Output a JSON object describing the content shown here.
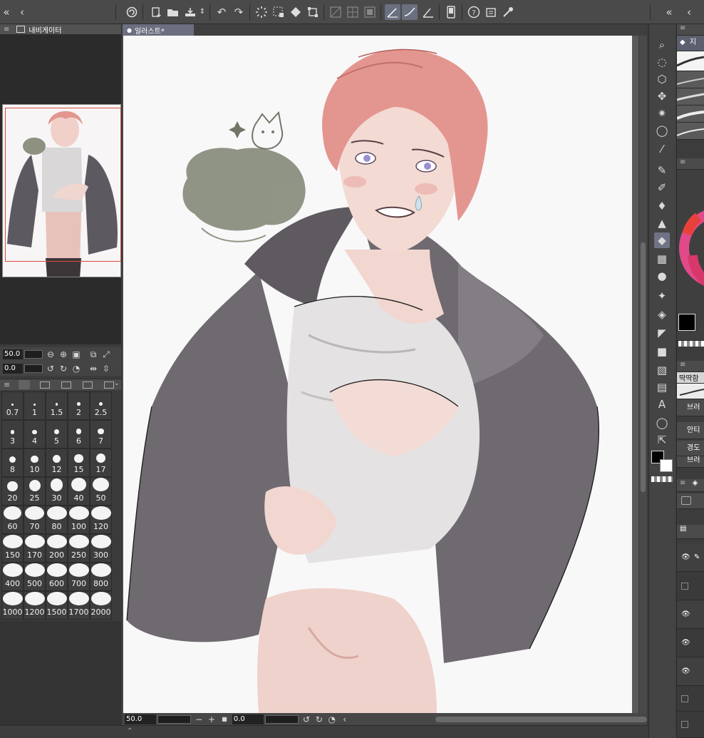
{
  "window": {
    "collapse_label": "«",
    "back_label": "‹"
  },
  "toolbar": {
    "icons": [
      "clip-studio-icon",
      "new-file-icon",
      "open-folder-icon",
      "save-icon",
      "undo-icon",
      "redo-icon",
      "loading-icon",
      "select-deselect-icon",
      "fill-icon",
      "transform-icon",
      "ruler-snap-icon",
      "grid-icon",
      "canvas-icon",
      "snap-ruler-icon",
      "snap-special-icon",
      "snap-grid-icon",
      "tablet-icon",
      "help-icon",
      "settings-icon",
      "eyedropper-icon"
    ]
  },
  "navigator": {
    "title": "내비게이터",
    "zoom_value": "50.0",
    "rotate_value": "0.0"
  },
  "brush_sizes": {
    "sizes": [
      "0.7",
      "1",
      "1.5",
      "2",
      "2.5",
      "3",
      "4",
      "5",
      "6",
      "7",
      "8",
      "10",
      "12",
      "15",
      "17",
      "20",
      "25",
      "30",
      "40",
      "50",
      "60",
      "70",
      "80",
      "100",
      "120",
      "150",
      "170",
      "200",
      "250",
      "300",
      "400",
      "500",
      "600",
      "700",
      "800",
      "1000",
      "1200",
      "1500",
      "1700",
      "2000"
    ]
  },
  "document": {
    "tab_title": "일러스트*"
  },
  "canvas_status": {
    "zoom_value": "50.0",
    "rotate_value": "0.0"
  },
  "right_panel": {
    "sub_tool_label": "지",
    "brush_name": "딱딱함",
    "setting_brush": "브러",
    "setting_antialias": "안티",
    "setting_hardness": "경도",
    "setting_more": "브러"
  },
  "colors": {
    "accent": "#6c6f80",
    "nav_frame": "#d84b3a",
    "hair": "#e3968f",
    "jacket": "#6f6a70",
    "shirt": "#e4e2e3",
    "skin": "#f2d6d0",
    "sketch": "#8b8f7e"
  }
}
